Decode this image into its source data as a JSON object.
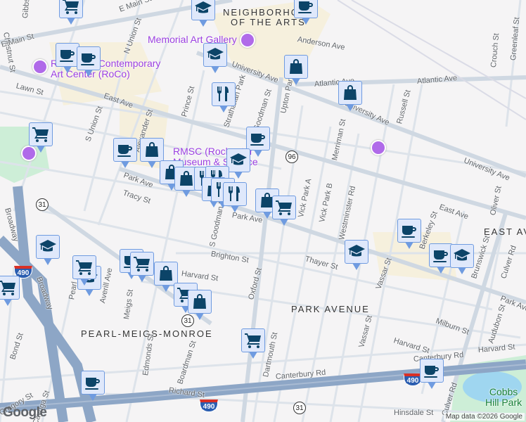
{
  "neighborhoods": {
    "arts_1": "NEIGHBORHOOD",
    "arts_2": "OF THE ARTS",
    "east_ave": "EAST AVE",
    "park_avenue": "PARK AVENUE",
    "pmm": "PEARL-MEIGS-MONROE"
  },
  "pois": {
    "memorial": "Memorial Art Gallery",
    "roco_1": "Rochester Contemporary",
    "roco_2": "Art Center (RoCo)",
    "rmsc_1": "RMSC (Rochester",
    "rmsc_2": "Museum & Science",
    "cobbs_1": "Cobbs",
    "cobbs_2": "Hill Park"
  },
  "streets": [
    "Gibbs St",
    "E Main St",
    "Chestnut St",
    "E Main St",
    "N Union St",
    "Anderson Ave",
    "University Ave",
    "Atlantic Ave",
    "Atlantic Ave",
    "Lawn St",
    "East Ave",
    "Prince St",
    "Strathallan Park",
    "Goodman St",
    "Upton Park",
    "University Ave",
    "Russell St",
    "S Union St",
    "Alexander St",
    "Merriman St",
    "University Ave",
    "Park Ave",
    "Tracy St",
    "Broadway",
    "S Goodman St",
    "Park Ave",
    "Vick Park A",
    "Vick Park B",
    "Westminster Rd",
    "East Ave",
    "Brighton St",
    "Thayer St",
    "Vassar St",
    "Berkeley St",
    "Culver Rd",
    "Oliver St",
    "Harvard St",
    "Oxford St",
    "Averill Ave",
    "Meigs St",
    "Pearl St",
    "Broadway",
    "Milburn St",
    "Harvard St",
    "Harvard St",
    "Dartmouth St",
    "Vassar St",
    "Audubon St",
    "Bond St",
    "Edmonds St",
    "Boardman St",
    "Canterbury Rd",
    "Canterbury Rd",
    "Richard St",
    "Cayuga St",
    "Gregory St",
    "Hinsdale St",
    "Culver Rd",
    "Crouch St",
    "Greenleaf St",
    "Brunswick St",
    "Park Ave"
  ],
  "shields": {
    "r96": "96",
    "r31": "31",
    "i490": "490"
  },
  "markers": [
    "cart",
    "school",
    "coffee",
    "coffee",
    "coffee",
    "school",
    "shopping-bag",
    "restaurant",
    "shopping-bag",
    "cart",
    "coffee",
    "coffee",
    "shopping-bag",
    "school",
    "shopping-bag",
    "shopping-bag",
    "restaurant",
    "restaurant",
    "shopping-bag",
    "restaurant",
    "restaurant",
    "shopping-bag",
    "cart",
    "coffee",
    "school",
    "coffee",
    "school",
    "school",
    "cart",
    "school",
    "coffee",
    "cart",
    "shopping-bag",
    "cart",
    "shopping-bag",
    "cart",
    "cart",
    "coffee",
    "coffee"
  ],
  "colors": {
    "marker_fill": "#dfe8fb",
    "marker_border": "#6f9be0",
    "icon": "#0c4468",
    "poi": "#9b3fe0",
    "highway": "#8da6c6"
  },
  "branding": {
    "logo": "Google",
    "attribution": "Map data ©2026 Google"
  }
}
